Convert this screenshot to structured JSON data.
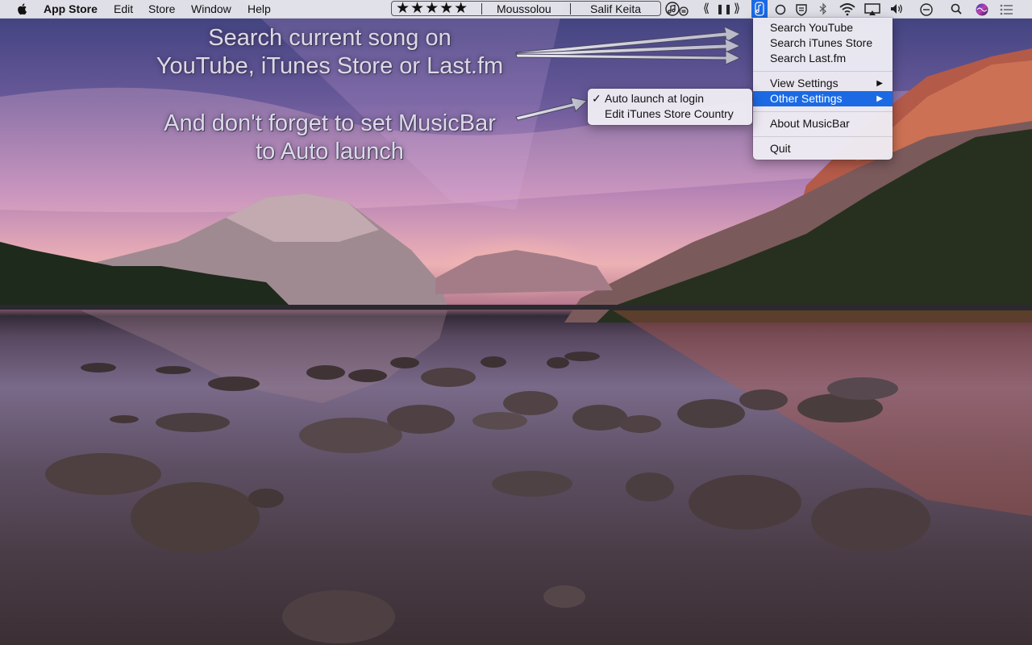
{
  "menubar": {
    "app_name": "App Store",
    "menus": [
      "Edit",
      "Store",
      "Window",
      "Help"
    ]
  },
  "musicbar": {
    "rating": "★★★★★",
    "song": "Moussolou",
    "artist": "Salif Keita",
    "controls": [
      "⟪",
      "❚❚",
      "⟫"
    ]
  },
  "status_icons": [
    "circle-icon",
    "shield-icon",
    "bluetooth-icon",
    "wifi-icon",
    "airplay-icon",
    "volume-icon",
    "do-not-disturb-icon",
    "search-icon",
    "siri-icon",
    "notification-center-icon"
  ],
  "annotations": {
    "line1": "Search current song on",
    "line2": "YouTube, iTunes Store or Last.fm",
    "line3": "And don't forget to set MusicBar",
    "line4": "to Auto launch"
  },
  "main_menu": {
    "items": [
      {
        "label": "Search YouTube"
      },
      {
        "label": "Search iTunes Store"
      },
      {
        "label": "Search Last.fm"
      },
      {
        "label": "View Settings",
        "submenu": true
      },
      {
        "label": "Other Settings",
        "submenu": true,
        "highlighted": true
      },
      {
        "label": "About MusicBar"
      },
      {
        "label": "Quit"
      }
    ]
  },
  "sub_menu": {
    "items": [
      {
        "label": "Auto launch at login",
        "checked": true
      },
      {
        "label": "Edit iTunes Store Country"
      }
    ],
    "check_mark": "✓"
  },
  "colors": {
    "highlight": "#1b6ae4",
    "menubar": "#ececf0"
  }
}
